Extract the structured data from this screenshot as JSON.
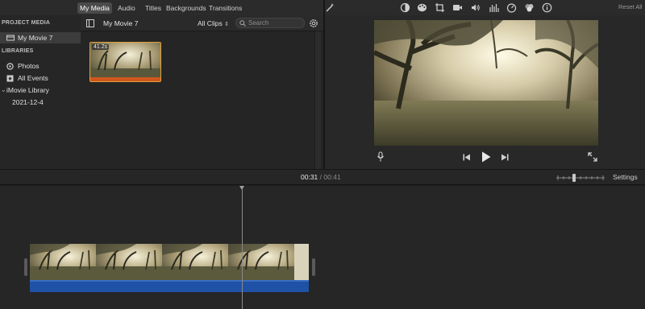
{
  "top_tabs": [
    "My Media",
    "Audio",
    "Titles",
    "Backgrounds",
    "Transitions"
  ],
  "reset_all": "Reset All",
  "sidebar": {
    "project_media_header": "PROJECT MEDIA",
    "project_item": "My Movie 7",
    "libraries_header": "LIBRARIES",
    "photos": "Photos",
    "all_events": "All Events",
    "library": "iMovie Library",
    "event": "2021-12-4"
  },
  "browser": {
    "title": "My Movie 7",
    "filter": "All Clips",
    "search_placeholder": "Search",
    "clip_duration": "41.2s"
  },
  "viewer_tools": [
    "magic-wand-icon",
    "color-balance-icon",
    "color-correction-icon",
    "crop-icon",
    "stabilization-icon",
    "volume-icon",
    "equalizer-icon",
    "speed-icon",
    "noise-reduction-icon",
    "info-icon"
  ],
  "timecode": {
    "current": "00:31",
    "separator": "/",
    "total": "00:41"
  },
  "settings_label": "Settings",
  "colors": {
    "accent_audio": "#1f52a6",
    "clip_selection": "#e0a23a",
    "clip_bar": "#d0561e"
  }
}
